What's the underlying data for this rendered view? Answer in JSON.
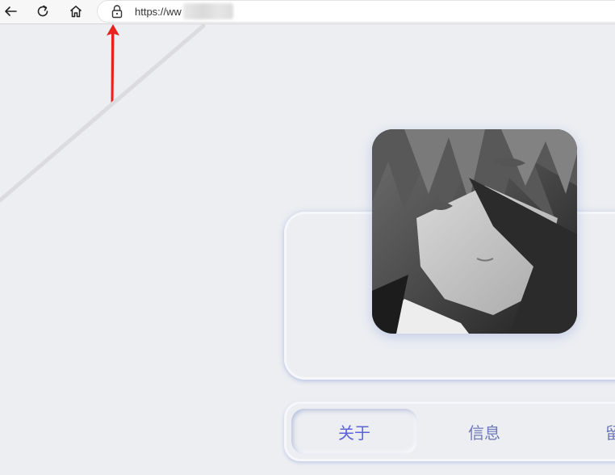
{
  "browser": {
    "url_text": "https://ww",
    "icons": [
      "back-arrow-icon",
      "reload-icon",
      "home-icon",
      "lock-icon"
    ]
  },
  "annotation": {
    "color": "#e8231f",
    "icon": "red-arrow-icon"
  },
  "profile": {
    "avatar_icon": "anime-avatar-image"
  },
  "tabs": [
    {
      "label": "关于"
    },
    {
      "label": "信息"
    },
    {
      "label": "留"
    }
  ],
  "colors": {
    "background": "#eceef2",
    "tab_text": "#6f79b8",
    "active_tab_text": "#5e63d9"
  }
}
